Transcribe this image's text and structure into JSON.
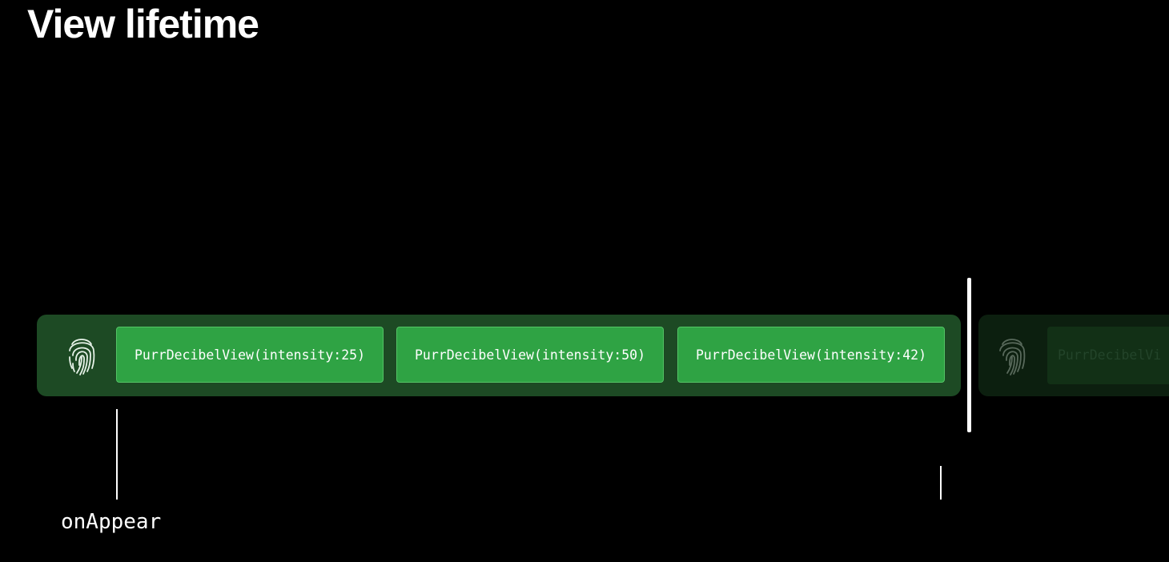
{
  "slide": {
    "title": "View lifetime"
  },
  "timeline": {
    "views": [
      {
        "label": "PurrDecibelView(intensity:25)"
      },
      {
        "label": "PurrDecibelView(intensity:50)"
      },
      {
        "label": "PurrDecibelView(intensity:42)"
      }
    ],
    "next_view_label": "PurrDecibelVi",
    "identity_icon": "fingerprint-icon",
    "event_label": "onAppear"
  },
  "colors": {
    "background": "#000000",
    "track": "#1d4a24",
    "view_box": "#2fa344",
    "text": "#ffffff"
  }
}
